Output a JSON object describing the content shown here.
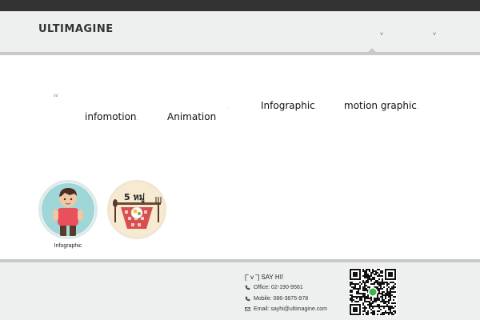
{
  "brand": {
    "logo_text": "ULTIMAGINE"
  },
  "nav": {
    "chevron_1": "˅",
    "chevron_2": "˅"
  },
  "tags": {
    "quote_mark": "“",
    "items": [
      {
        "label": "infomotion",
        "sep": "."
      },
      {
        "label": "Animation",
        "sep": "."
      },
      {
        "label": "Infographic",
        "sep": "."
      },
      {
        "label": "motion graphic",
        "sep": "."
      }
    ]
  },
  "gallery": {
    "items": [
      {
        "caption": "Infographic",
        "art": "boy-character"
      },
      {
        "caption": "",
        "art": "five-food-groups"
      }
    ],
    "badge_text": "5 หมู่"
  },
  "footer": {
    "say_hi": "[˘ v ˘] SAY HI!",
    "office": "Office: 02-190-9561",
    "mobile": "Mobile: 086-3875-978",
    "email": "Email: sayhi@ultimagine.com"
  },
  "colors": {
    "topbar": "#333333",
    "header_bg": "#eef0ef",
    "rule": "#c8caca",
    "thumb_1_bg": "#9fd6d8",
    "thumb_2_bg": "#f6ead2"
  }
}
